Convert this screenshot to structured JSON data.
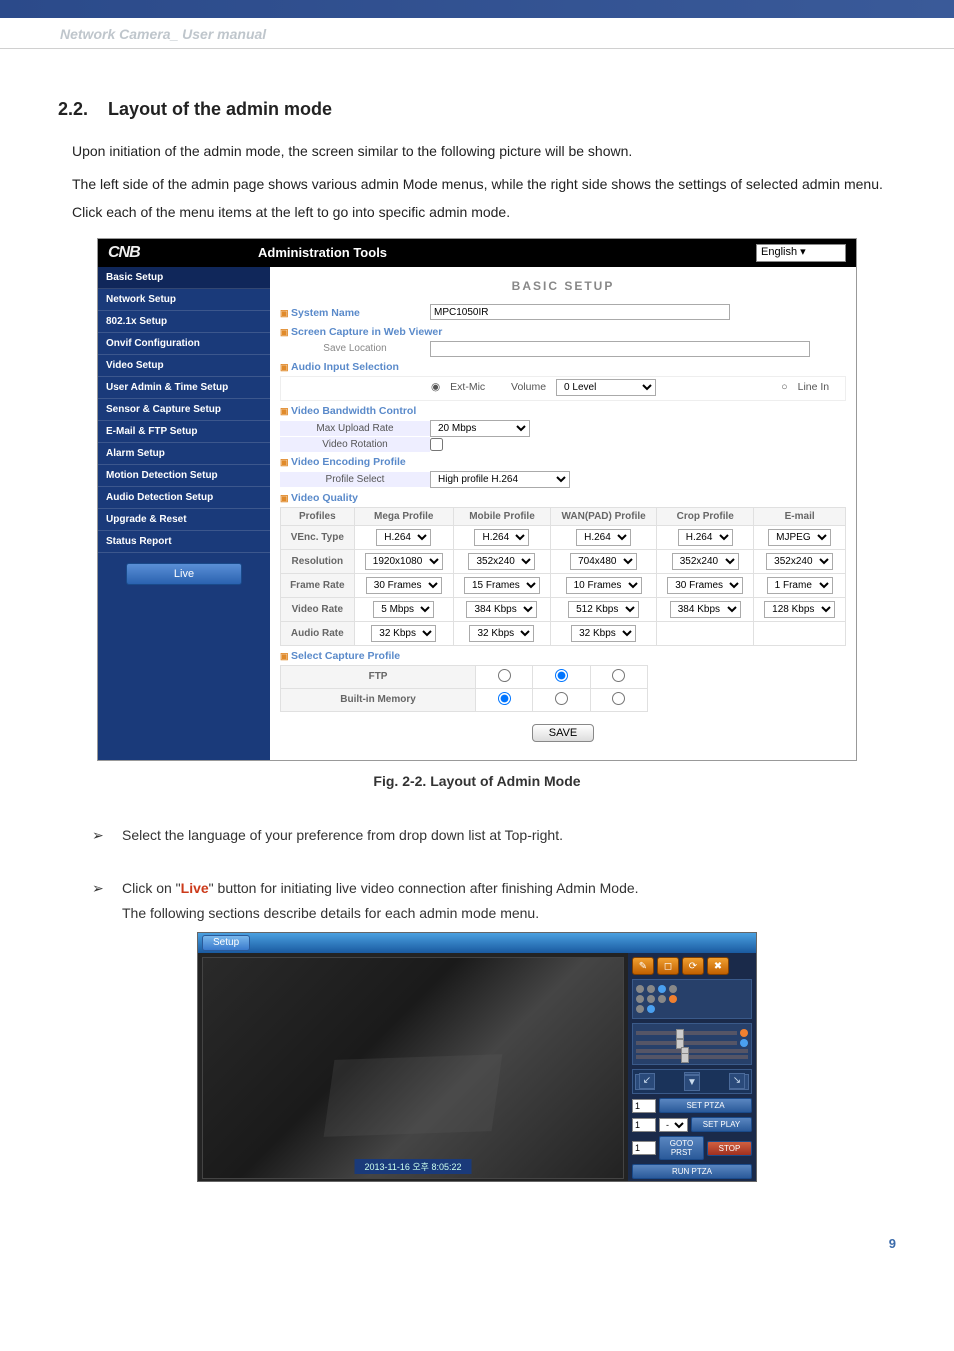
{
  "doc": {
    "header_text": "Network Camera_ User manual",
    "section_number": "2.2.",
    "section_title": "Layout of the admin mode",
    "para1": "Upon initiation of the admin mode, the screen similar to the following picture will be shown.",
    "para2": "The left side of the admin page shows various admin Mode menus, while the right side shows the settings of selected admin menu. Click each of the menu items at the left to go into specific admin mode.",
    "fig_caption": "Fig. 2-2. Layout of Admin Mode",
    "bullet1": "Select the language of your preference from drop down list at Top-right.",
    "bullet2_pre": "Click on \"",
    "bullet2_live": "Live",
    "bullet2_post": "\" button for initiating live video connection after finishing Admin Mode.",
    "bullet2_line2": "The following sections describe details for each admin mode menu.",
    "page_number": "9"
  },
  "admin": {
    "logo": "CNB",
    "title": "Administration Tools",
    "language": "English",
    "menu": {
      "m0": "Basic Setup",
      "m1": "Network Setup",
      "m2": "802.1x Setup",
      "m3": "Onvif Configuration",
      "m4": "Video Setup",
      "m5": "User Admin & Time Setup",
      "m6": "Sensor & Capture Setup",
      "m7": "E-Mail & FTP Setup",
      "m8": "Alarm Setup",
      "m9": "Motion Detection Setup",
      "m10": "Audio Detection Setup",
      "m11": "Upgrade & Reset",
      "m12": "Status Report",
      "live": "Live"
    },
    "main": {
      "heading": "BASIC SETUP",
      "system_name_label": "System Name",
      "system_name_value": "MPC1050IR",
      "screen_capture_label": "Screen Capture in Web Viewer",
      "save_location_label": "Save Location",
      "audio_input_label": "Audio Input Selection",
      "ext_mic": "Ext-Mic",
      "volume": "Volume",
      "volume_val": "0 Level",
      "line_in": "Line In",
      "bandwidth_label": "Video Bandwidth Control",
      "max_upload_label": "Max Upload Rate",
      "max_upload_val": "20 Mbps",
      "video_rotation_label": "Video Rotation",
      "encoding_label": "Video Encoding Profile",
      "profile_select_label": "Profile Select",
      "profile_select_val": "High profile H.264",
      "vq_label": "Video Quality",
      "cols": {
        "c0": "Profiles",
        "c1": "Mega Profile",
        "c2": "Mobile Profile",
        "c3": "WAN(PAD) Profile",
        "c4": "Crop Profile",
        "c5": "E-mail"
      },
      "rows": {
        "venc_label": "VEnc. Type",
        "venc_c1": "H.264",
        "venc_c2": "H.264",
        "venc_c3": "H.264",
        "venc_c4": "H.264",
        "venc_c5": "MJPEG",
        "res_label": "Resolution",
        "res_c1": "1920x1080",
        "res_c2": "352x240",
        "res_c3": "704x480",
        "res_c4": "352x240",
        "res_c5": "352x240",
        "fr_label": "Frame Rate",
        "fr_c1": "30 Frames",
        "fr_c2": "15 Frames",
        "fr_c3": "10 Frames",
        "fr_c4": "30 Frames",
        "fr_c5": "1 Frame",
        "vr_label": "Video Rate",
        "vr_c1": "5 Mbps",
        "vr_c2": "384 Kbps",
        "vr_c3": "512 Kbps",
        "vr_c4": "384 Kbps",
        "vr_c5": "128 Kbps",
        "ar_label": "Audio Rate",
        "ar_c1": "32 Kbps",
        "ar_c2": "32 Kbps",
        "ar_c3": "32 Kbps"
      },
      "capture_label": "Select Capture Profile",
      "ftp_label": "FTP",
      "mem_label": "Built-in Memory",
      "save_btn": "SAVE"
    }
  },
  "live": {
    "setup_btn": "Setup",
    "timestamp": "2013-11-16 오후 8:05:22",
    "preset1": "1",
    "preset2": "1",
    "preset3": "1",
    "btn_set_ptz": "SET PTZA",
    "btn_set_play": "SET PLAY",
    "btn_goto": "GOTO PRST",
    "btn_run": "RUN PTZA",
    "btn_stop": "STOP"
  }
}
